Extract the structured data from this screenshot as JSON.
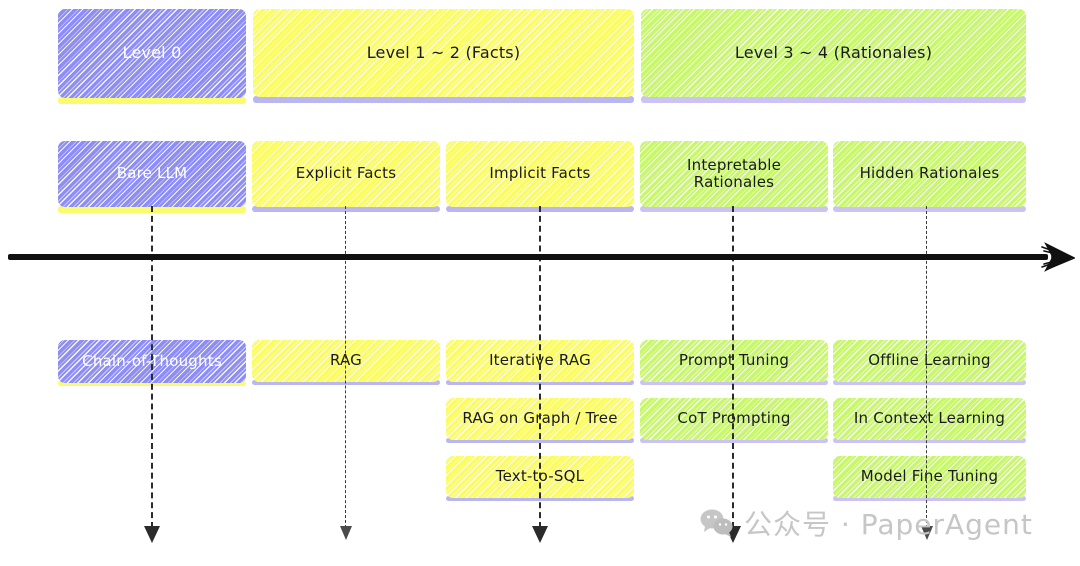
{
  "diagram": {
    "title": "LLM Knowledge Levels Taxonomy",
    "colors": {
      "blue": "#8d8df5",
      "yellow": "#fbfb62",
      "green": "#c8f76e",
      "shadow_lavender": "#b9b6f0",
      "axis": "#101010"
    },
    "level_bands": [
      {
        "label": "Level 0",
        "color": "blue"
      },
      {
        "label": "Level 1 ~ 2 (Facts)",
        "color": "yellow"
      },
      {
        "label": "Level 3 ~ 4 (Rationales)",
        "color": "green"
      }
    ],
    "categories": [
      {
        "label": "Bare LLM",
        "color": "blue"
      },
      {
        "label": "Explicit Facts",
        "color": "yellow"
      },
      {
        "label": "Implicit Facts",
        "color": "yellow"
      },
      {
        "label": "Intepretable\nRationales",
        "color": "green"
      },
      {
        "label": "Hidden Rationales",
        "color": "green"
      }
    ],
    "category_labels": {
      "bare_llm": "Bare LLM",
      "explicit_facts": "Explicit Facts",
      "implicit_facts": "Implicit Facts",
      "intepretable_rationales_line1": "Intepretable",
      "intepretable_rationales_line2": "Rationales",
      "hidden_rationales": "Hidden Rationales"
    },
    "methods": {
      "column_1": [
        "Chain-of-Thoughts"
      ],
      "column_2": [
        "RAG"
      ],
      "column_3": [
        "Iterative RAG",
        "RAG on Graph / Tree",
        "Text-to-SQL"
      ],
      "column_4": [
        "Prompt Tuning",
        "CoT Prompting"
      ],
      "column_5": [
        "Offline Learning",
        "In Context Learning",
        "Model Fine Tuning"
      ]
    },
    "method_items": {
      "chain_of_thoughts": "Chain-of-Thoughts",
      "rag": "RAG",
      "iterative_rag": "Iterative RAG",
      "rag_on_graph_tree": "RAG on Graph / Tree",
      "text_to_sql": "Text-to-SQL",
      "prompt_tuning": "Prompt Tuning",
      "cot_prompting": "CoT Prompting",
      "offline_learning": "Offline Learning",
      "in_context_learning": "In Context Learning",
      "model_fine_tuning": "Model Fine Tuning"
    }
  },
  "watermark": {
    "icon": "wechat-icon",
    "text": "公众号 · PaperAgent"
  }
}
